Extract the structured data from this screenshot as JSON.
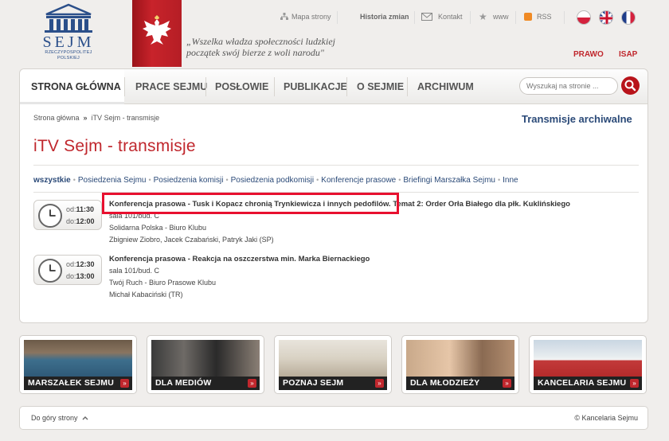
{
  "header": {
    "logo_word": "SEJM",
    "logo_sub1": "RZECZYPOSPOLITEJ",
    "logo_sub2": "POLSKIEJ",
    "motto_line1": "„Wszelka władza społeczności ludzkiej",
    "motto_line2": "początek swój bierze z woli narodu\"",
    "links": {
      "mapa": "Mapa strony",
      "historia": "Historia zmian",
      "kontakt": "Kontakt",
      "www": "www",
      "rss": "RSS"
    },
    "prawo": "PRAWO",
    "isap": "ISAP"
  },
  "nav": {
    "items": [
      "STRONA GŁÓWNA",
      "PRACE SEJMU",
      "POSŁOWIE",
      "PUBLIKACJE",
      "O SEJMIE",
      "ARCHIWUM"
    ],
    "search_placeholder": "Wyszukaj na stronie ..."
  },
  "breadcrumb": {
    "home": "Strona główna",
    "sep": "»",
    "current": "iTV Sejm - transmisje"
  },
  "archive_link": "Transmisje archiwalne",
  "page_title": "iTV Sejm - transmisje",
  "filters": [
    "wszystkie",
    "Posiedzenia Sejmu",
    "Posiedzenia komisji",
    "Posiedzenia podkomisji",
    "Konferencje prasowe",
    "Briefingi Marszałka Sejmu",
    "Inne"
  ],
  "events": [
    {
      "od_label": "od:",
      "do_label": "do:",
      "from": "11:30",
      "to": "12:00",
      "title": "Konferencja prasowa - Tusk i Kopacz chronią Trynkiewicza i innych pedofilów. Temat 2: Order Orła Białego dla płk. Kuklińskiego",
      "room": "sala 101/bud. C",
      "org": "Solidarna Polska - Biuro Klubu",
      "people": "Zbigniew Ziobro, Jacek Czabański, Patryk Jaki (SP)"
    },
    {
      "od_label": "od:",
      "do_label": "do:",
      "from": "12:30",
      "to": "13:00",
      "title": "Konferencja prasowa - Reakcja na oszczerstwa min. Marka Biernackiego",
      "room": "sala 101/bud. C",
      "org": "Twój Ruch - Biuro Prasowe Klubu",
      "people": "Michał Kabaciński (TR)"
    }
  ],
  "banners": [
    "MARSZAŁEK SEJMU",
    "DLA MEDIÓW",
    "POZNAJ SEJM",
    "DLA MŁODZIEŻY",
    "KANCELARIA SEJMU"
  ],
  "banner_arrow": "»",
  "footer": {
    "top": "Do góry strony",
    "copyright": "© Kancelaria Sejmu"
  },
  "colors": {
    "accent_red": "#c0272d",
    "link_blue": "#2b4a78",
    "highlight": "#e8102f"
  }
}
